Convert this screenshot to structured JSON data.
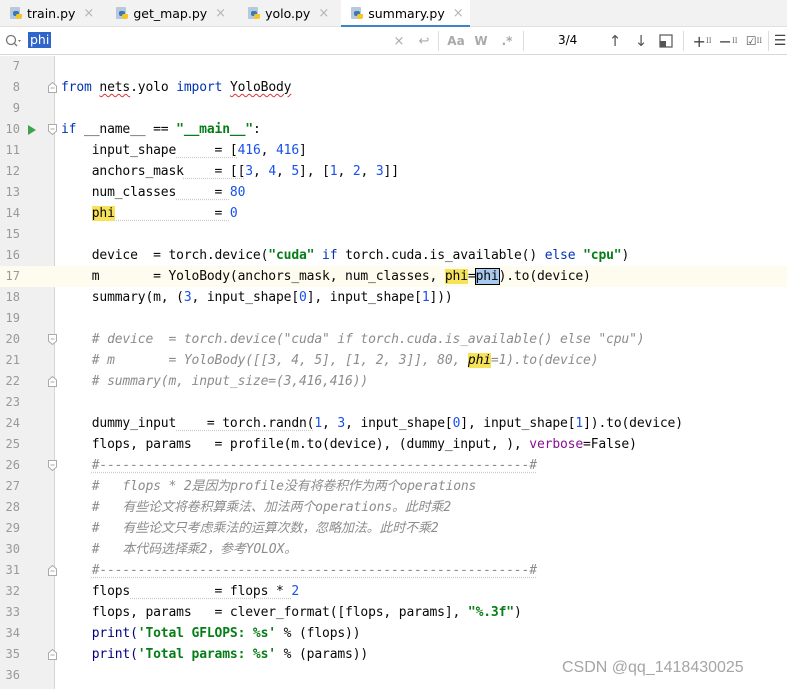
{
  "tabs": [
    {
      "name": "train.py",
      "active": false,
      "icon": "python-file-icon",
      "close": "×"
    },
    {
      "name": "get_map.py",
      "active": false,
      "icon": "python-file-icon",
      "close": "×"
    },
    {
      "name": "yolo.py",
      "active": false,
      "icon": "python-file-icon",
      "close": "×"
    },
    {
      "name": "summary.py",
      "active": true,
      "icon": "python-file-icon",
      "close": "×"
    }
  ],
  "search": {
    "value": "phi",
    "match_count": "3/4",
    "clear_icon": "×",
    "newline_icon": "↩",
    "match_case_label": "Aa",
    "words_label": "W",
    "regex_label": ".*",
    "prev_icon": "↑",
    "next_icon": "↓",
    "ii_label": "II"
  },
  "editor": {
    "current_line": 17,
    "lines": [
      {
        "n": "7"
      },
      {
        "n": "8"
      },
      {
        "n": "9"
      },
      {
        "n": "10"
      },
      {
        "n": "11"
      },
      {
        "n": "12"
      },
      {
        "n": "13"
      },
      {
        "n": "14"
      },
      {
        "n": "15"
      },
      {
        "n": "16"
      },
      {
        "n": "17"
      },
      {
        "n": "18"
      },
      {
        "n": "19"
      },
      {
        "n": "20"
      },
      {
        "n": "21"
      },
      {
        "n": "22"
      },
      {
        "n": "23"
      },
      {
        "n": "24"
      },
      {
        "n": "25"
      },
      {
        "n": "26"
      },
      {
        "n": "27"
      },
      {
        "n": "28"
      },
      {
        "n": "29"
      },
      {
        "n": "30"
      },
      {
        "n": "31"
      },
      {
        "n": "32"
      },
      {
        "n": "33"
      },
      {
        "n": "34"
      },
      {
        "n": "35"
      },
      {
        "n": "36"
      }
    ],
    "tok": {
      "from": "from",
      "nets": "nets",
      "dot_yolo": ".yolo ",
      "import": "import",
      "YoloBody": "YoloBody",
      "if": "if",
      "name_eq": " __name__ == ",
      "main_str": "\"__main__\"",
      "colon": ":",
      "input_shape": "input_shape",
      "eq_pad_is": "     = [",
      "n416a": "416",
      "comma_sp": ", ",
      "n416b": "416",
      "rbr": "]",
      "anchors_mask": "anchors_mask",
      "eq_pad_am": "    = [[",
      "n3": "3",
      "n4": "4",
      "n5": "5",
      "am_mid": "], [",
      "n1": "1",
      "n2": "2",
      "n3b": "3",
      "am_end": "]]",
      "num_classes": "num_classes",
      "eq_pad_nc": "     = ",
      "n80": "80",
      "phi": "phi",
      "eq_pad_phi": "             = ",
      "n0": "0",
      "device": "device",
      "dev_rest1": "  = torch.device(",
      "cuda_str": "\"cuda\"",
      "sp": " ",
      "if2": "if",
      "dev_rest2": " torch.cuda.is_available() ",
      "else": "else",
      "cpu_str": "\"cpu\"",
      "rparen": ")",
      "m": "m",
      "m_rest1": "       = YoloBody(anchors_mask, num_classes, ",
      "phi_kw": "phi",
      "eq": "=",
      "phi_val": "phi",
      "m_rest2": ").to(device)",
      "summary_pre": "summary(m, (",
      "sum_n3": "3",
      "sum_mid1": ", input_shape[",
      "sum_n0": "0",
      "sum_mid2": "], input_shape[",
      "sum_n1": "1",
      "sum_end": "]))",
      "c20": "# device  = torch.device(\"cuda\" if torch.cuda.is_available() else \"cpu\")",
      "c21a": "# m       = YoloBody([[3, 4, 5], [1, 2, 3]], 80, ",
      "c21phi": "phi",
      "c21b": "=1).to(device)",
      "c22": "# summary(m, input_size=(3,416,416))",
      "dummy_input": "dummy_input",
      "di_rest1": "    = torch.randn(",
      "di_n1": "1",
      "di_n3": "3",
      "di_mid": ", input_shape[",
      "di_n0": "0",
      "di_mid2": "], input_shape[",
      "di_n1b": "1",
      "di_end": "]).to(device)",
      "fp": "flops, params",
      "fp_rest1": "   = profile(m.to(device), (dummy_input, ), ",
      "verbose": "verbose",
      "false_val": "=False)",
      "c26": "#--------------------------------------------------------#",
      "c27": "#   flops * 2是因为profile没有将卷积作为两个operations",
      "c28": "#   有些论文将卷积算乘法、加法两个operations。此时乘2",
      "c29": "#   有些论文只考虑乘法的运算次数，忽略加法。此时不乘2",
      "c30": "#   本代码选择乘2，参考YOLOX。",
      "c31": "#--------------------------------------------------------#",
      "flops": "flops",
      "fl_rest": "           = flops * ",
      "fl_n2": "2",
      "cf_rest": "   = clever_format([flops, params], ",
      "fmt_str": "\"%.3f\"",
      "print": "print(",
      "gflops_str": "'Total GFLOPS: %s'",
      "pr1_rest": " % (flops))",
      "params_str": "'Total params: %s'",
      "pr2_rest": " % (params))"
    }
  },
  "watermark": "CSDN @qq_1418430025"
}
